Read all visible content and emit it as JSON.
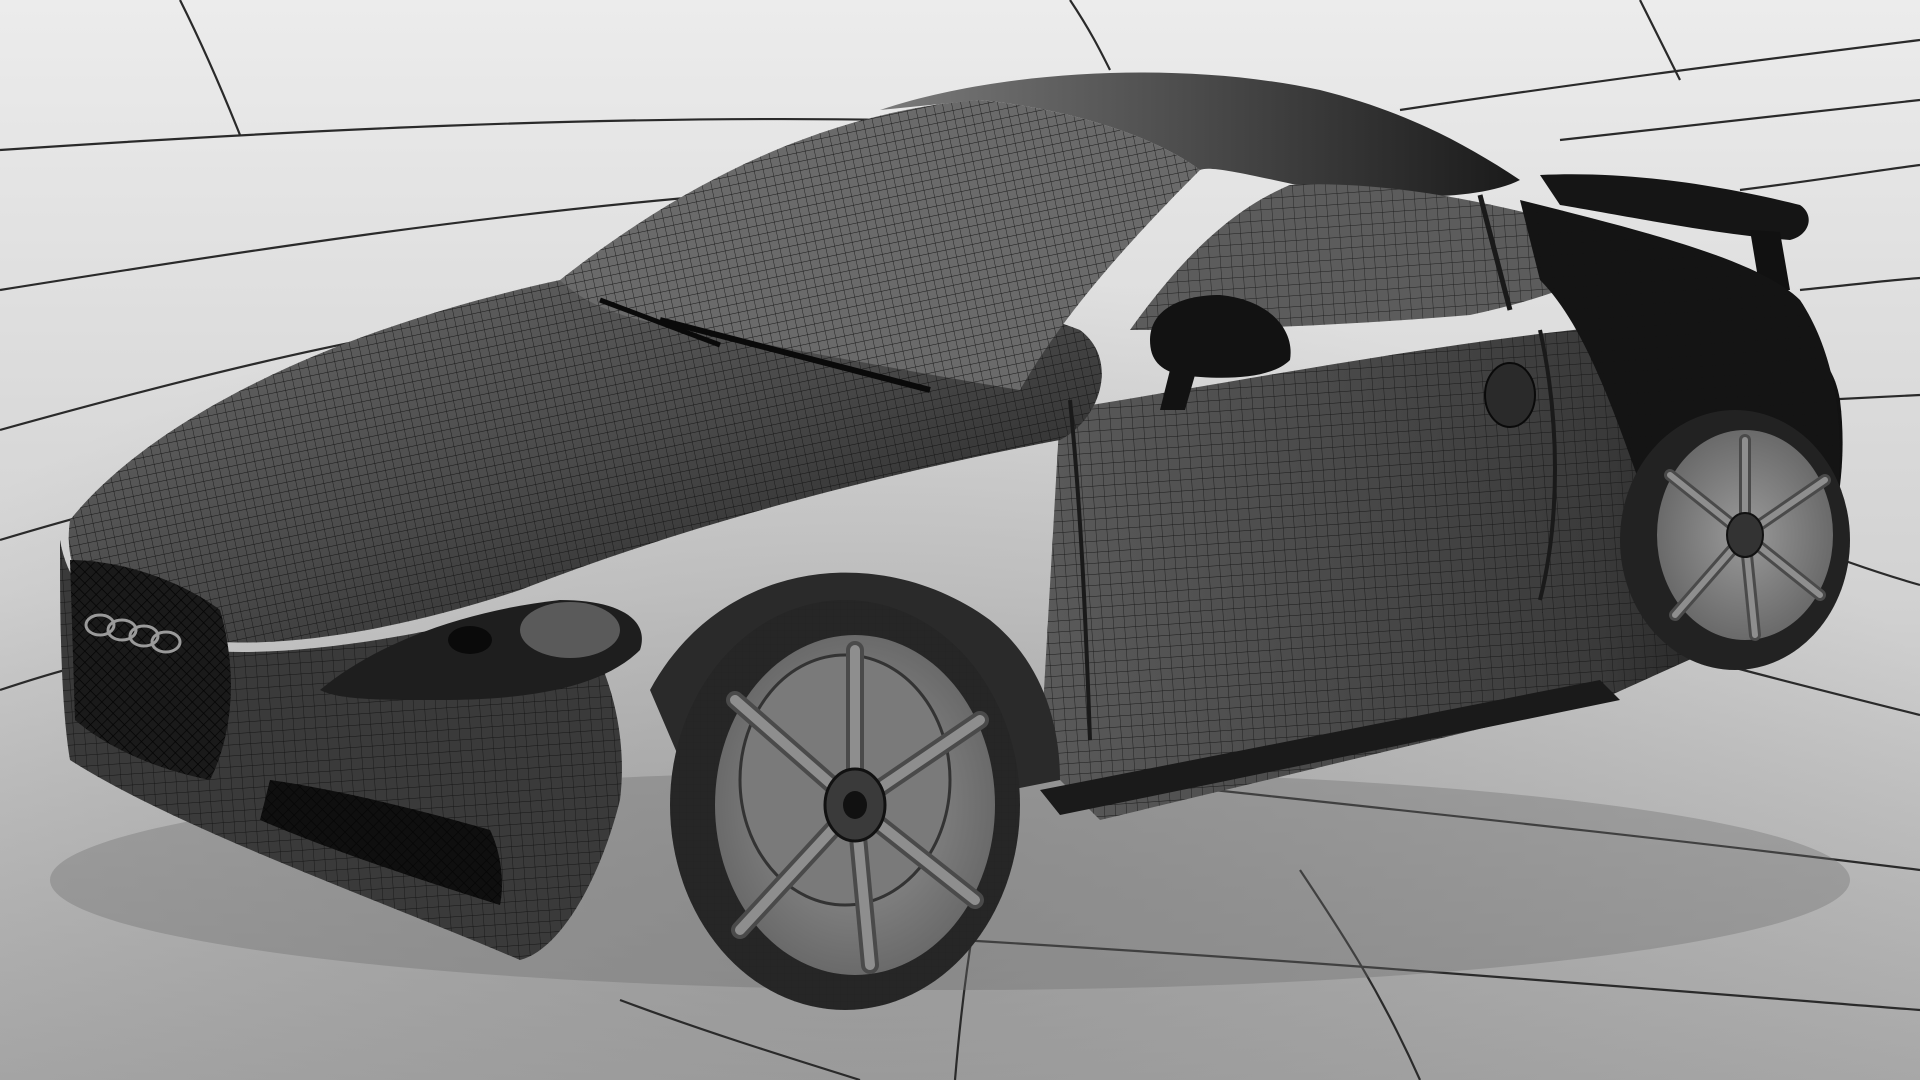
{
  "scene": {
    "subject": "wireframe-sports-coupe",
    "render_style": "grayscale-wireframe-mesh",
    "colors": {
      "background_light": "#e6e6e6",
      "background_mid": "#c9c9c9",
      "background_dark": "#9a9a9a",
      "floor_lines": "#222222",
      "body_base": "#4a4a4a",
      "body_shadow": "#1a1a1a",
      "mesh_line": "#111111",
      "wheel_rim": "#8a8a8a",
      "tire": "#2a2a2a",
      "glass": "#6a6a6a"
    }
  }
}
